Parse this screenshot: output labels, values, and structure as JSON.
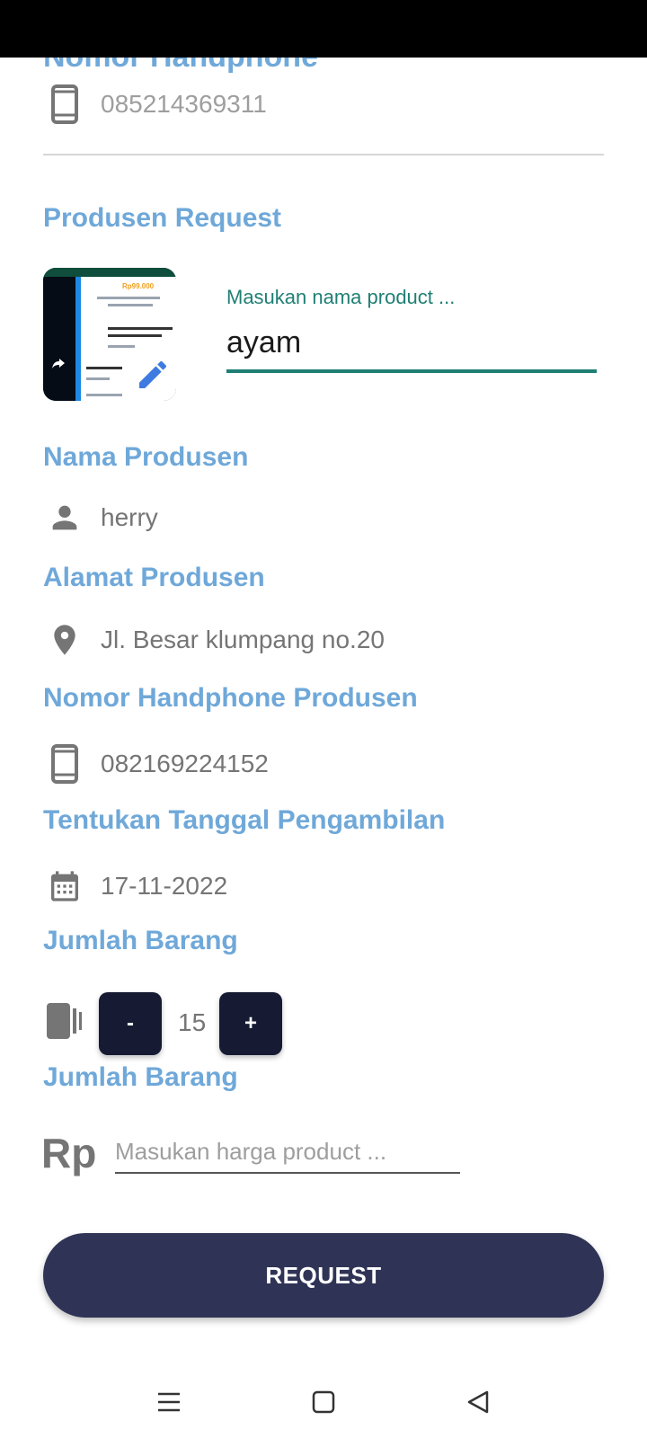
{
  "phone_section": {
    "title": "Nomor Handphone",
    "value": "085214369311"
  },
  "request": {
    "title": "Produsen Request",
    "product_field": {
      "label": "Masukan nama product ...",
      "value": "ayam"
    }
  },
  "producer": {
    "name_title": "Nama Produsen",
    "name": "herry",
    "address_title": "Alamat Produsen",
    "address": "Jl. Besar klumpang no.20",
    "phone_title": "Nomor Handphone Produsen",
    "phone": "082169224152"
  },
  "pickup": {
    "title": "Tentukan Tanggal Pengambilan",
    "date": "17-11-2022"
  },
  "quantity": {
    "title": "Jumlah Barang",
    "minus_label": "-",
    "plus_label": "+",
    "value": "15"
  },
  "price": {
    "title": "Jumlah Barang",
    "currency": "Rp",
    "placeholder": "Masukan harga product ..."
  },
  "submit_label": "REQUEST",
  "thumbnail": {
    "price_text": "Rp99.000"
  },
  "colors": {
    "accent_title": "#6fa8d9",
    "field_accent": "#1f7f74",
    "button_dark": "#161b33",
    "request_button": "#2f3456"
  },
  "nav": {
    "icons": [
      "menu-icon",
      "home-square-icon",
      "back-triangle-icon"
    ]
  }
}
